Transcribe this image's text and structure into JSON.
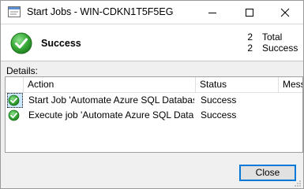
{
  "window": {
    "title": "Start Jobs - WIN-CDKN1T5F5EG",
    "app_icon": "jobs-window-icon",
    "controls": {
      "minimize_icon": "minimize-icon",
      "maximize_icon": "maximize-icon",
      "close_icon": "close-icon"
    }
  },
  "summary": {
    "status_icon": "success-check-icon",
    "status_label": "Success",
    "total_count": "2",
    "total_label": "Total",
    "success_count": "2",
    "success_label": "Success"
  },
  "details": {
    "label": "Details:",
    "columns": [
      {
        "label": ""
      },
      {
        "label": "Action"
      },
      {
        "label": "Status"
      },
      {
        "label": "Message"
      }
    ],
    "rows": [
      {
        "icon": "success-check-icon",
        "action": "Start Job 'Automate Azure SQL Database'",
        "status": "Success",
        "message": ""
      },
      {
        "icon": "success-check-icon",
        "action": "Execute job 'Automate Azure SQL Database'",
        "status": "Success",
        "message": ""
      }
    ]
  },
  "footer": {
    "close_label": "Close"
  },
  "colors": {
    "accent": "#0078d7",
    "success_green": "#2e9a2e",
    "dialog_bg": "#f0f0f0"
  }
}
